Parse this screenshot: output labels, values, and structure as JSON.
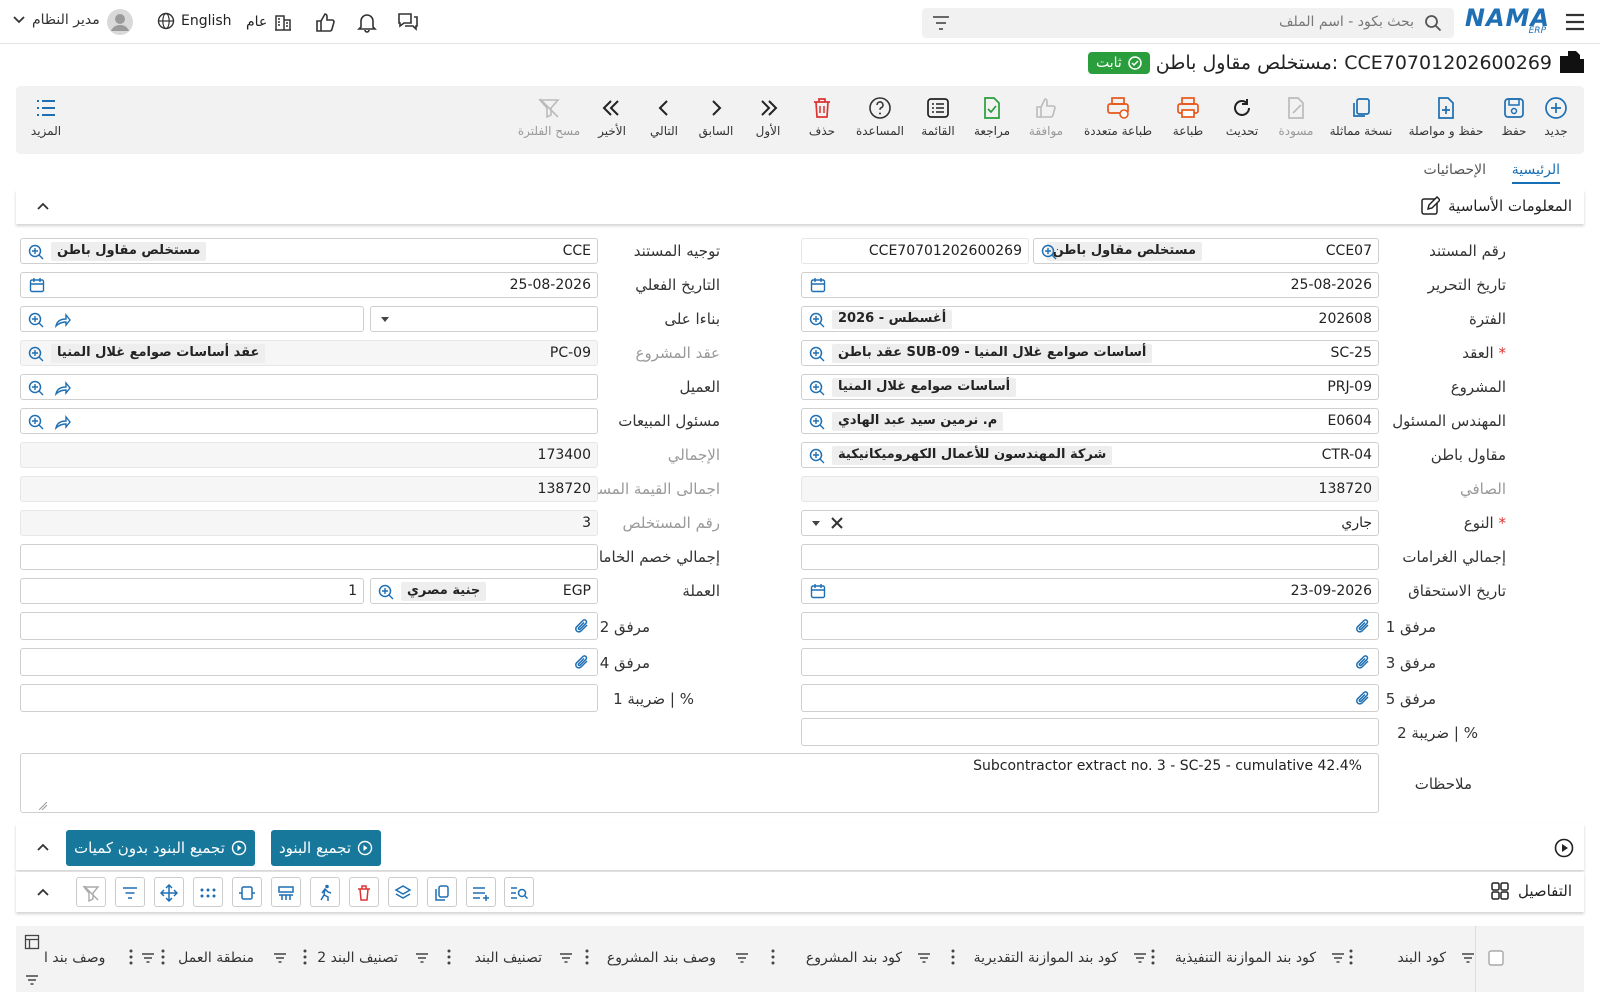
{
  "topbar": {
    "search_placeholder": "بحث بكود - اسم الملف",
    "logo": "NAMA",
    "logo_sub": "ERP",
    "user_name": "مدير النظام",
    "language": "English",
    "scope": "عام"
  },
  "doc": {
    "title": "مستخلص مقاول باطن: CCE70701202600269",
    "status": "ثابت"
  },
  "toolbar": [
    {
      "label": "جديد",
      "icon": "plus-circle-icon"
    },
    {
      "label": "حفظ",
      "icon": "save-icon"
    },
    {
      "label": "حفظ و مواصلة",
      "icon": "file-plus-icon"
    },
    {
      "label": "نسخة مماثلة",
      "icon": "copy-icon"
    },
    {
      "label": "مسودة",
      "icon": "draft-icon"
    },
    {
      "label": "تحديث",
      "icon": "refresh-icon"
    },
    {
      "label": "طباعة",
      "icon": "print-icon"
    },
    {
      "label": "طباعة متعددة",
      "icon": "multi-print-icon"
    },
    {
      "label": "موافقة",
      "icon": "thumbs-up-icon"
    },
    {
      "label": "مراجعة",
      "icon": "review-icon"
    },
    {
      "label": "القائمة",
      "icon": "list-icon"
    },
    {
      "label": "المساعدة",
      "icon": "help-icon"
    },
    {
      "label": "حذف",
      "icon": "trash-icon"
    },
    {
      "label": "الأول",
      "icon": "first-icon"
    },
    {
      "label": "السابق",
      "icon": "prev-icon"
    },
    {
      "label": "التالي",
      "icon": "next-icon"
    },
    {
      "label": "الأخير",
      "icon": "last-icon"
    },
    {
      "label": "مسح الفلترة",
      "icon": "clear-filter-icon"
    },
    {
      "label": "المزيد",
      "icon": "more-icon"
    }
  ],
  "tabs": {
    "main": "الرئيسية",
    "stats": "الإحصائيات"
  },
  "section": {
    "basic": "المعلومات الأساسية",
    "details": "التفاصيل"
  },
  "form": {
    "doc_no_label": "رقم المستند",
    "doc_no_code": "CCE07",
    "doc_no_name": "مستخلص مقاول باطن",
    "doc_no_value": "CCE70701202600269",
    "doc_dir_label": "توجيه المستند",
    "doc_dir_code": "CCE",
    "doc_dir_name": "مستخلص مقاول باطن",
    "edit_date_label": "تاريخ التحرير",
    "edit_date": "25-08-2026",
    "actual_date_label": "التاريخ الفعلي",
    "actual_date": "25-08-2026",
    "period_label": "الفترة",
    "period_code": "202608",
    "period_name": "2026 - أغسطس",
    "based_on_label": "بناءا على",
    "contract_label": "العقد",
    "contract_code": "SC-25",
    "contract_name": "عقد باطن SUB-09 - أساسات صوامع غلال المنيا",
    "proj_contract_label": "عقد المشروع",
    "proj_contract_code": "PC-09",
    "proj_contract_name": "عقد أساسات صوامع غلال المنيا",
    "project_label": "المشروع",
    "project_code": "PRJ-09",
    "project_name": "أساسات صوامع غلال المنيا",
    "client_label": "العميل",
    "engineer_label": "المهندس المسئول",
    "engineer_code": "E0604",
    "engineer_name": "م. نرمين سيد عبد الهادي",
    "sales_label": "مسئول المبيعات",
    "subcontractor_label": "مقاول باطن",
    "subcontractor_code": "CTR-04",
    "subcontractor_name": "شركة المهندسون للأعمال الكهروميكانيكية",
    "total_label": "الإجمالي",
    "total": "173400",
    "net_label": "الصافي",
    "net": "138720",
    "due_total_label": "اجمالى القيمة المستحقة",
    "due_total": "138720",
    "type_label": "النوع",
    "type": "جاري",
    "extract_no_label": "رقم المستخلص",
    "extract_no": "3",
    "fines_label": "إجمالي الغرامات",
    "materials_label": "إجمالي خصم الخامات",
    "due_date_label": "تاريخ الاستحقاق",
    "due_date": "23-09-2026",
    "currency_label": "العملة",
    "currency_code": "EGP",
    "currency_name": "جنية مصري",
    "currency_rate": "1",
    "att1_label": "مرفق 1",
    "att2_label": "مرفق 2",
    "att3_label": "مرفق 3",
    "att4_label": "مرفق 4",
    "att5_label": "مرفق 5",
    "tax1_label": "ضريبة 1 | %",
    "tax2_label": "ضريبة 2 | %",
    "notes_label": "ملاحظات",
    "notes": "Subcontractor extract no. 3 - SC-25 - cumulative 42.4%"
  },
  "actions": {
    "group_items": "تجميع البنود",
    "group_items_no_qty": "تجميع البنود بدون كميات"
  },
  "grid": {
    "columns": [
      "كود البند",
      "كود بند الموازنة التنفيذية",
      "كود بند الموازنة التقديرية",
      "كود بند المشروع",
      "وصف بند المشروع",
      "تصنيف البند",
      "تصنيف البند 2",
      "منطقة العمل",
      "وصف بند ا"
    ]
  }
}
